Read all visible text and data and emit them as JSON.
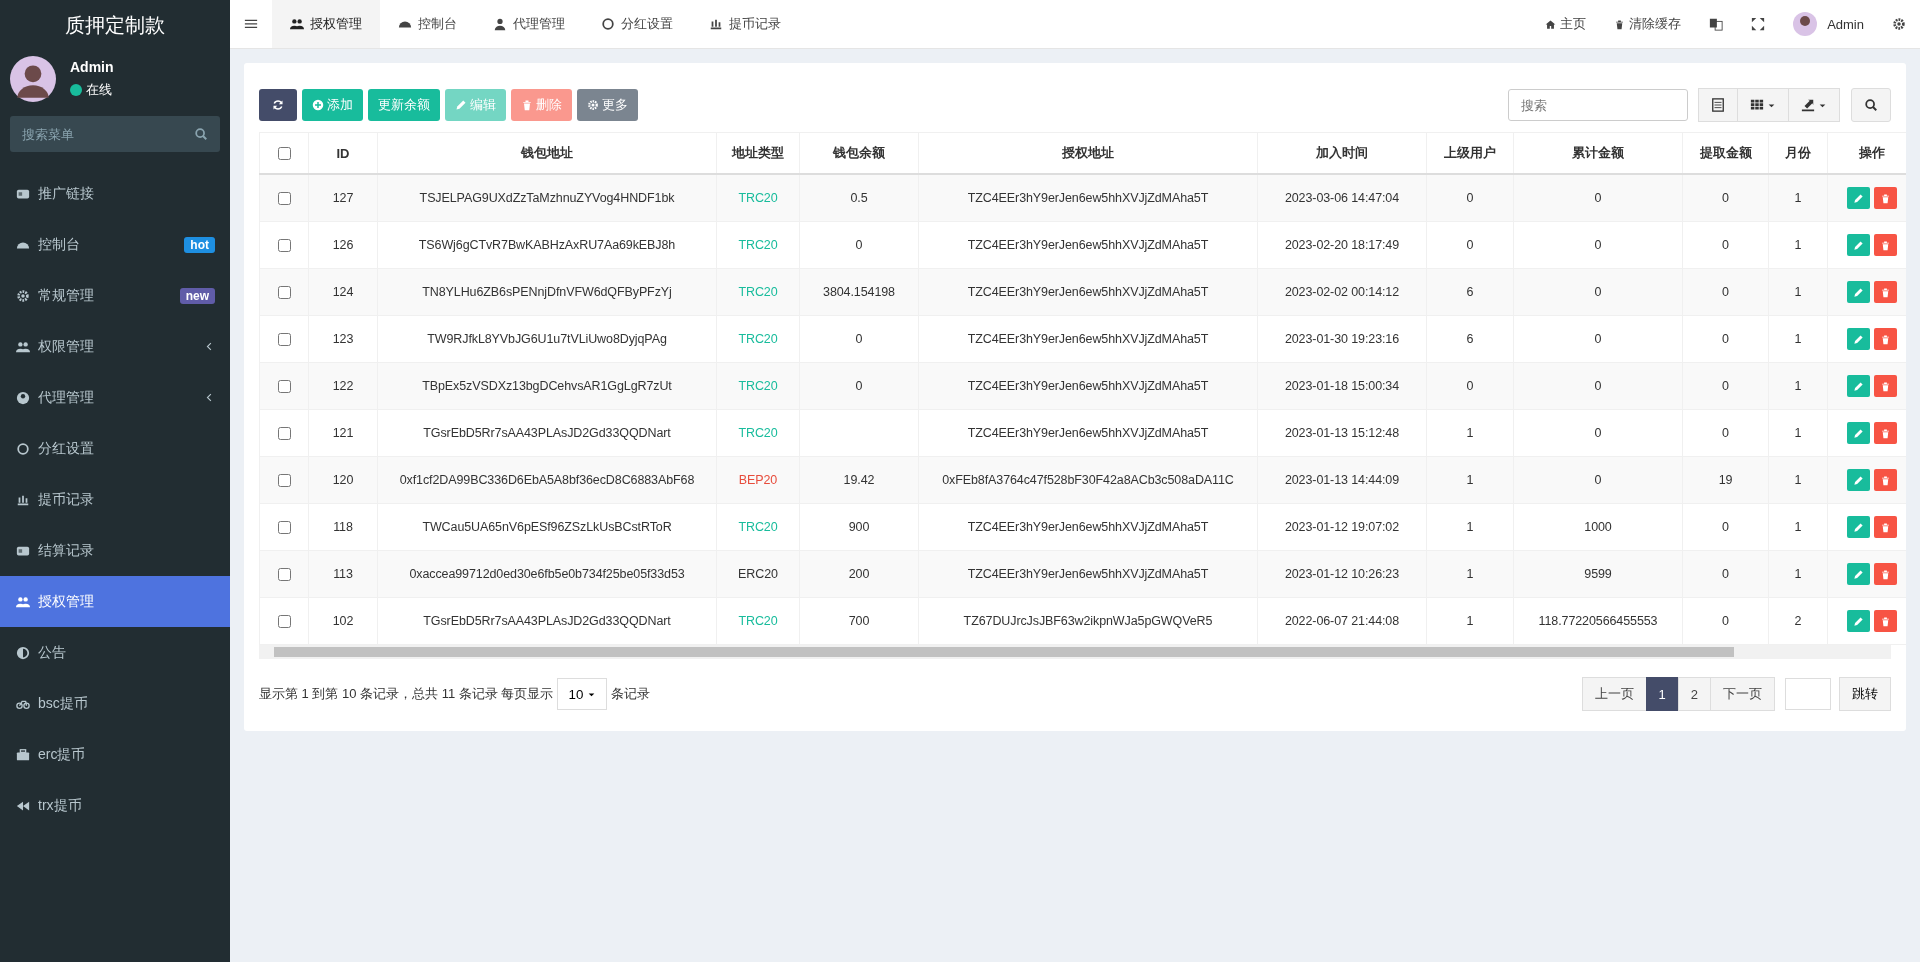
{
  "sidebar": {
    "title": "质押定制款",
    "user": {
      "name": "Admin",
      "status": "在线",
      "online": true
    },
    "search": {
      "placeholder": "搜索菜单"
    },
    "items": [
      {
        "label": "推广链接",
        "selected": false,
        "has_submenu": false
      },
      {
        "label": "控制台",
        "selected": false,
        "has_submenu": false,
        "badge": {
          "text": "hot",
          "color": "#1e8fe1"
        }
      },
      {
        "label": "常规管理",
        "selected": false,
        "has_submenu": false,
        "badge": {
          "text": "new",
          "color": "#605ca8"
        }
      },
      {
        "label": "权限管理",
        "selected": false,
        "has_submenu": true
      },
      {
        "label": "代理管理",
        "selected": false,
        "has_submenu": true
      },
      {
        "label": "分红设置",
        "selected": false,
        "has_submenu": false
      },
      {
        "label": "提币记录",
        "selected": false,
        "has_submenu": false
      },
      {
        "label": "结算记录",
        "selected": false,
        "has_submenu": false
      },
      {
        "label": "授权管理",
        "selected": true,
        "has_submenu": false
      },
      {
        "label": "公告",
        "selected": false,
        "has_submenu": false
      },
      {
        "label": "bsc提币",
        "selected": false,
        "has_submenu": false
      },
      {
        "label": "erc提币",
        "selected": false,
        "has_submenu": false
      },
      {
        "label": "trx提币",
        "selected": false,
        "has_submenu": false
      }
    ]
  },
  "tabs": [
    {
      "label": "授权管理",
      "selected": true
    },
    {
      "label": "控制台",
      "selected": false
    },
    {
      "label": "代理管理",
      "selected": false
    },
    {
      "label": "分红设置",
      "selected": false
    },
    {
      "label": "提币记录",
      "selected": false
    }
  ],
  "topbar_right": {
    "links": [
      "主页",
      "清除缓存"
    ],
    "user": "Admin"
  },
  "toolbar": {
    "buttons": [
      {
        "kind": "refresh",
        "disabled": false
      },
      {
        "kind": "add",
        "label": "添加",
        "disabled": false
      },
      {
        "kind": "update",
        "label": "更新余额",
        "disabled": false
      },
      {
        "kind": "edit",
        "label": "编辑",
        "disabled": true
      },
      {
        "kind": "delete",
        "label": "删除",
        "disabled": true
      },
      {
        "kind": "more",
        "label": "更多",
        "disabled": false
      }
    ],
    "search": {
      "placeholder": "搜索"
    }
  },
  "table": {
    "header_checked": false,
    "columns": [
      "ID",
      "钱包地址",
      "地址类型",
      "钱包余额",
      "授权地址",
      "加入时间",
      "上级用户",
      "累计金额",
      "提取金额",
      "月份",
      "操作"
    ],
    "rows": [
      {
        "checked": false,
        "id": "127",
        "wallet": "TSJELPAG9UXdZzTaMzhnuZYVog4HNDF1bk",
        "type": {
          "text": "TRC20",
          "color": "#18bc9c"
        },
        "balance": "0.5",
        "auth": "TZC4EEr3hY9erJen6ew5hhXVJjZdMAha5T",
        "time": "2023-03-06 14:47:04",
        "parent": "0",
        "total": "0",
        "withdrawn": "0",
        "month": "1"
      },
      {
        "checked": false,
        "id": "126",
        "wallet": "TS6Wj6gCTvR7BwKABHzAxRU7Aa69kEBJ8h",
        "type": {
          "text": "TRC20",
          "color": "#18bc9c"
        },
        "balance": "0",
        "auth": "TZC4EEr3hY9erJen6ew5hhXVJjZdMAha5T",
        "time": "2023-02-20 18:17:49",
        "parent": "0",
        "total": "0",
        "withdrawn": "0",
        "month": "1"
      },
      {
        "checked": false,
        "id": "124",
        "wallet": "TN8YLHu6ZB6sPENnjDfnVFW6dQFByPFzYj",
        "type": {
          "text": "TRC20",
          "color": "#18bc9c"
        },
        "balance": "3804.154198",
        "auth": "TZC4EEr3hY9erJen6ew5hhXVJjZdMAha5T",
        "time": "2023-02-02 00:14:12",
        "parent": "6",
        "total": "0",
        "withdrawn": "0",
        "month": "1"
      },
      {
        "checked": false,
        "id": "123",
        "wallet": "TW9RJfkL8YVbJG6U1u7tVLiUwo8DyjqPAg",
        "type": {
          "text": "TRC20",
          "color": "#18bc9c"
        },
        "balance": "0",
        "auth": "TZC4EEr3hY9erJen6ew5hhXVJjZdMAha5T",
        "time": "2023-01-30 19:23:16",
        "parent": "6",
        "total": "0",
        "withdrawn": "0",
        "month": "1"
      },
      {
        "checked": false,
        "id": "122",
        "wallet": "TBpEx5zVSDXz13bgDCehvsAR1GgLgR7zUt",
        "type": {
          "text": "TRC20",
          "color": "#18bc9c"
        },
        "balance": "0",
        "auth": "TZC4EEr3hY9erJen6ew5hhXVJjZdMAha5T",
        "time": "2023-01-18 15:00:34",
        "parent": "0",
        "total": "0",
        "withdrawn": "0",
        "month": "1"
      },
      {
        "checked": false,
        "id": "121",
        "wallet": "TGsrEbD5Rr7sAA43PLAsJD2Gd33QQDNart",
        "type": {
          "text": "TRC20",
          "color": "#18bc9c"
        },
        "auth": "TZC4EEr3hY9erJen6ew5hhXVJjZdMAha5T",
        "time": "2023-01-13 15:12:48",
        "parent": "1",
        "total": "0",
        "withdrawn": "0",
        "month": "1"
      },
      {
        "checked": false,
        "id": "120",
        "wallet": "0xf1cf2DA99BC336D6EbA5A8bf36ecD8C6883AbF68",
        "type": {
          "text": "BEP20",
          "color": "#e74c3c"
        },
        "balance": "19.42",
        "auth": "0xFEb8fA3764c47f528bF30F42a8ACb3c508aDA11C",
        "time": "2023-01-13 14:44:09",
        "parent": "1",
        "total": "0",
        "withdrawn": "19",
        "month": "1"
      },
      {
        "checked": false,
        "id": "118",
        "wallet": "TWCau5UA65nV6pESf96ZSzLkUsBCstRToR",
        "type": {
          "text": "TRC20",
          "color": "#18bc9c"
        },
        "balance": "900",
        "auth": "TZC4EEr3hY9erJen6ew5hhXVJjZdMAha5T",
        "time": "2023-01-12 19:07:02",
        "parent": "1",
        "total": "1000",
        "withdrawn": "0",
        "month": "1"
      },
      {
        "checked": false,
        "id": "113",
        "wallet": "0xaccea99712d0ed30e6fb5e0b734f25be05f33d53",
        "type": {
          "text": "ERC20",
          "color": "#333333"
        },
        "balance": "200",
        "auth": "TZC4EEr3hY9erJen6ew5hhXVJjZdMAha5T",
        "time": "2023-01-12 10:26:23",
        "parent": "1",
        "total": "9599",
        "withdrawn": "0",
        "month": "1"
      },
      {
        "checked": false,
        "id": "102",
        "wallet": "TGsrEbD5Rr7sAA43PLAsJD2Gd33QQDNart",
        "type": {
          "text": "TRC20",
          "color": "#18bc9c"
        },
        "balance": "700",
        "auth": "TZ67DUJrcJsJBF63w2ikpnWJa5pGWQVeR5",
        "time": "2022-06-07 21:44:08",
        "parent": "1",
        "total": "118.77220566455553",
        "withdrawn": "0",
        "month": "2"
      }
    ]
  },
  "pagination": {
    "info_before": "显示第 1 到第 10 条记录，总共 11 条记录 每页显示",
    "page_size": "10",
    "info_after": "条记录",
    "pages": [
      {
        "label": "上一页",
        "selected": false
      },
      {
        "label": "1",
        "selected": true
      },
      {
        "label": "2",
        "selected": false
      },
      {
        "label": "下一页",
        "selected": false
      }
    ],
    "jump_button": "跳转"
  }
}
